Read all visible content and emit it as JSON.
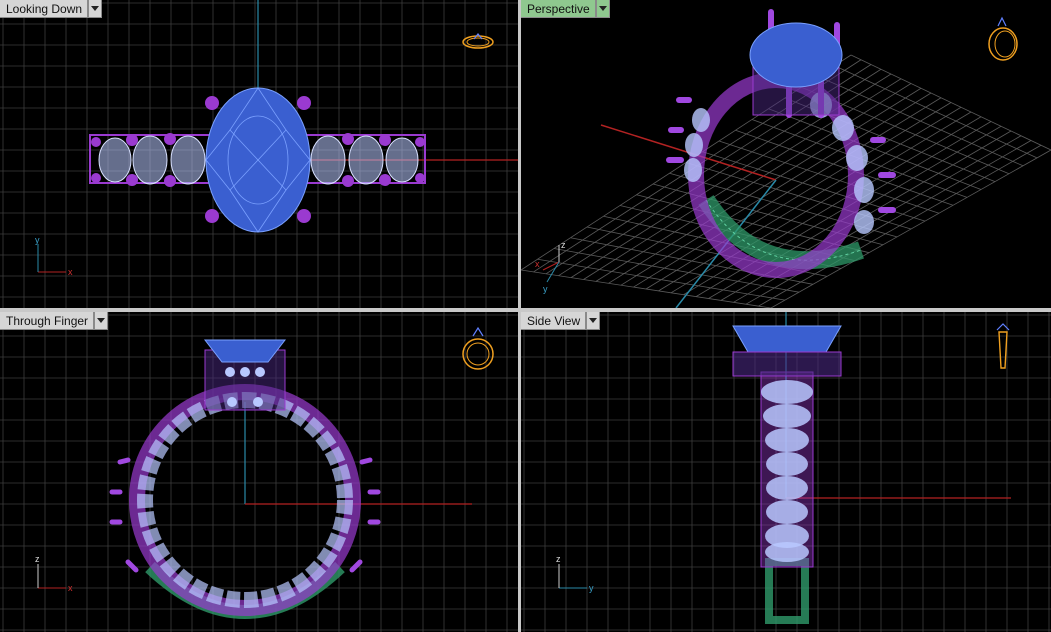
{
  "viewports": {
    "top": {
      "title": "Looking Down",
      "active": false
    },
    "perspective": {
      "title": "Perspective",
      "active": true
    },
    "front": {
      "title": "Through Finger",
      "active": false
    },
    "right": {
      "title": "Side View",
      "active": false
    }
  },
  "axis_labels": {
    "x": "x",
    "y": "y",
    "z": "z"
  },
  "colors": {
    "background": "#000000",
    "grid": "#3c3c3c",
    "grid_major": "#5a5a5a",
    "axis_x": "#b22222",
    "axis_y": "#2a8aa8",
    "stone_center": "#3a5fd0",
    "stone_side": "#b8c8ff",
    "prongs": "#9a3ad0",
    "shank": "#2f9a6a",
    "active_tab": "#8fc88f",
    "inactive_tab": "#d6d6d6",
    "nav_icon": "#f0a020"
  },
  "icons": {
    "viewport_menu": "dropdown-arrow-icon",
    "view_cube": "ring-orientation-icon"
  }
}
